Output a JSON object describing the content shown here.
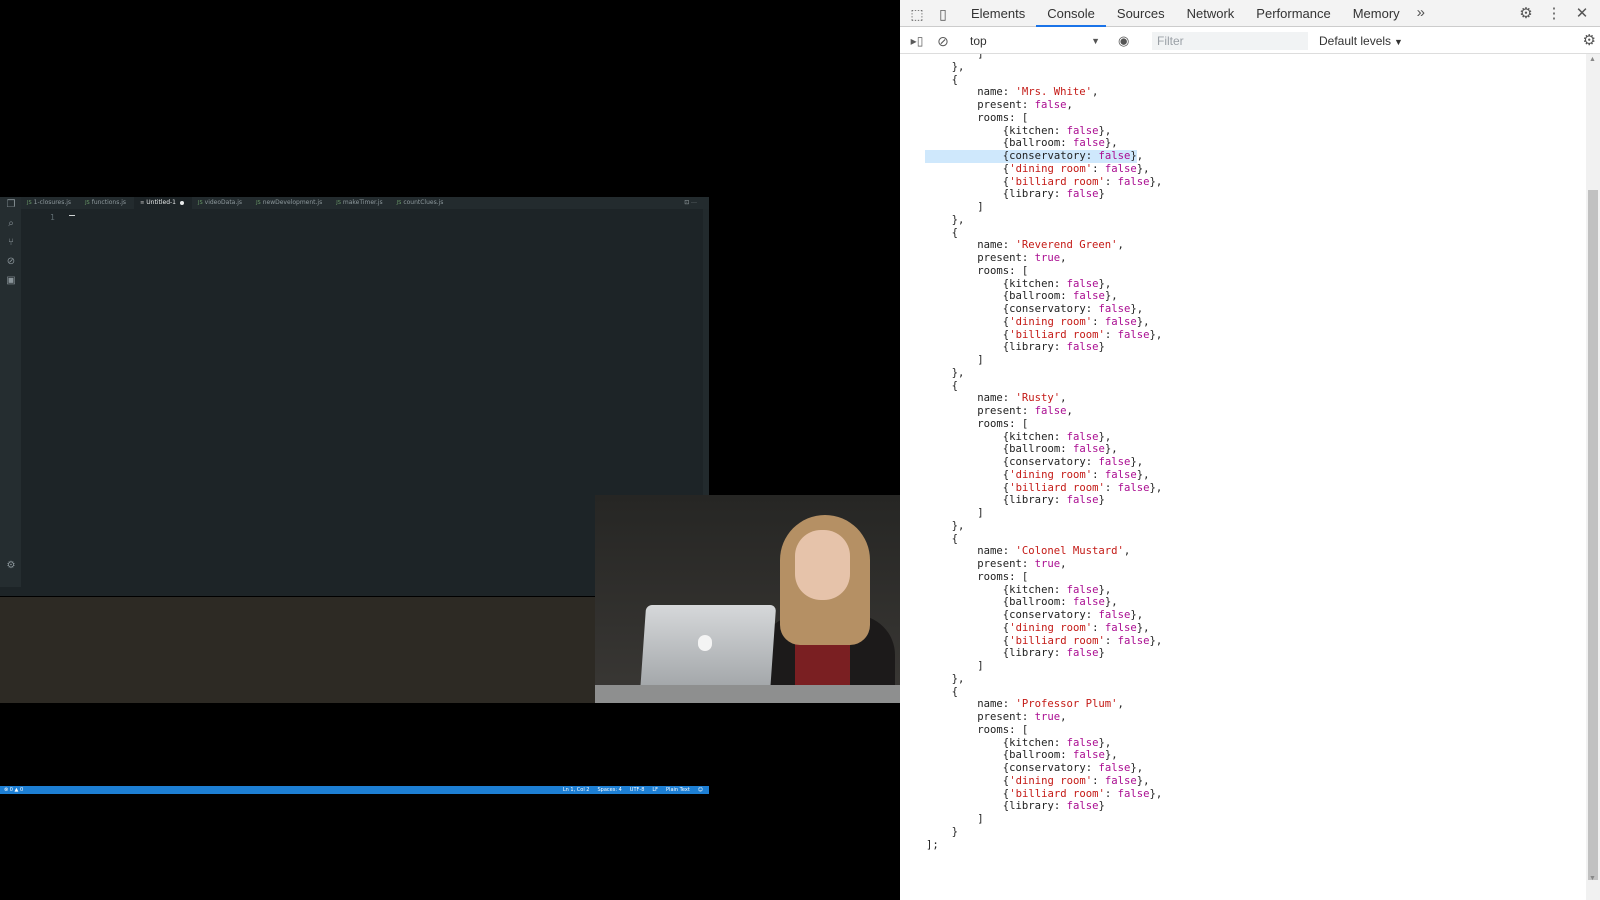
{
  "editor": {
    "tabs": [
      {
        "name": "1-closures.js",
        "active": false
      },
      {
        "name": "functions.js",
        "active": false
      },
      {
        "name": "Untitled-1",
        "active": true,
        "dirty": true
      },
      {
        "name": "videoData.js",
        "active": false
      },
      {
        "name": "newDevelopment.js",
        "active": false
      },
      {
        "name": "makeTimer.js",
        "active": false
      },
      {
        "name": "countClues.js",
        "active": false
      }
    ],
    "file_icon": "js-file-icon",
    "line_number": "1",
    "actions": "⊡  ···",
    "status": {
      "problems": "⊗ 0 ▲ 0",
      "position": "Ln 1, Col 2",
      "spaces": "Spaces: 4",
      "encoding": "UTF-8",
      "eol": "LF",
      "language": "Plain Text",
      "feedback": "☺"
    },
    "status_color": "#1d7fd4"
  },
  "devtools": {
    "tabs": [
      "Elements",
      "Console",
      "Sources",
      "Network",
      "Performance",
      "Memory"
    ],
    "active_tab": "Console",
    "more_icon": "»",
    "context": "top",
    "filter_placeholder": "Filter",
    "levels": "Default levels",
    "icons": {
      "inspect": "inspect-icon",
      "device": "device-toolbar-icon",
      "settings": "gear-icon",
      "menu": "kebab-menu-icon",
      "close": "close-icon",
      "sidebar": "sidebar-toggle-icon",
      "clear": "clear-console-icon",
      "eye": "eye-icon"
    },
    "colors": {
      "active_tab_underline": "#1a73e8",
      "string": "#c41a16",
      "boolean": "#aa0d91",
      "selection": "#cfe8fc"
    }
  },
  "console": {
    "lines": [
      {
        "indent": 8,
        "parts": [
          [
            "p",
            "]"
          ]
        ]
      },
      {
        "indent": 4,
        "parts": [
          [
            "p",
            "},"
          ]
        ]
      },
      {
        "indent": 4,
        "parts": [
          [
            "p",
            "{"
          ]
        ]
      },
      {
        "indent": 8,
        "parts": [
          [
            "k",
            "name: "
          ],
          [
            "s",
            "'Mrs. White'"
          ],
          [
            "p",
            ","
          ]
        ]
      },
      {
        "indent": 8,
        "parts": [
          [
            "k",
            "present: "
          ],
          [
            "b",
            "false"
          ],
          [
            "p",
            ","
          ]
        ]
      },
      {
        "indent": 8,
        "parts": [
          [
            "k",
            "rooms: ["
          ]
        ]
      },
      {
        "indent": 12,
        "parts": [
          [
            "p",
            "{kitchen: "
          ],
          [
            "b",
            "false"
          ],
          [
            "p",
            "},"
          ]
        ]
      },
      {
        "indent": 12,
        "parts": [
          [
            "p",
            "{ballroom: "
          ],
          [
            "b",
            "false"
          ],
          [
            "p",
            "},"
          ]
        ]
      },
      {
        "indent": 12,
        "sel": true,
        "parts": [
          [
            "p",
            "{conservatory: "
          ],
          [
            "b",
            "false"
          ],
          [
            "p",
            "},"
          ]
        ]
      },
      {
        "indent": 12,
        "parts": [
          [
            "p",
            "{"
          ],
          [
            "s",
            "'dining room'"
          ],
          [
            "p",
            ": "
          ],
          [
            "b",
            "false"
          ],
          [
            "p",
            "},"
          ]
        ]
      },
      {
        "indent": 12,
        "parts": [
          [
            "p",
            "{"
          ],
          [
            "s",
            "'billiard room'"
          ],
          [
            "p",
            ": "
          ],
          [
            "b",
            "false"
          ],
          [
            "p",
            "},"
          ]
        ]
      },
      {
        "indent": 12,
        "parts": [
          [
            "p",
            "{library: "
          ],
          [
            "b",
            "false"
          ],
          [
            "p",
            "}"
          ]
        ]
      },
      {
        "indent": 8,
        "parts": [
          [
            "p",
            "]"
          ]
        ]
      },
      {
        "indent": 4,
        "parts": [
          [
            "p",
            "},"
          ]
        ]
      },
      {
        "indent": 4,
        "parts": [
          [
            "p",
            "{"
          ]
        ]
      },
      {
        "indent": 8,
        "parts": [
          [
            "k",
            "name: "
          ],
          [
            "s",
            "'Reverend Green'"
          ],
          [
            "p",
            ","
          ]
        ]
      },
      {
        "indent": 8,
        "parts": [
          [
            "k",
            "present: "
          ],
          [
            "b",
            "true"
          ],
          [
            "p",
            ","
          ]
        ]
      },
      {
        "indent": 8,
        "parts": [
          [
            "k",
            "rooms: ["
          ]
        ]
      },
      {
        "indent": 12,
        "parts": [
          [
            "p",
            "{kitchen: "
          ],
          [
            "b",
            "false"
          ],
          [
            "p",
            "},"
          ]
        ]
      },
      {
        "indent": 12,
        "parts": [
          [
            "p",
            "{ballroom: "
          ],
          [
            "b",
            "false"
          ],
          [
            "p",
            "},"
          ]
        ]
      },
      {
        "indent": 12,
        "parts": [
          [
            "p",
            "{conservatory: "
          ],
          [
            "b",
            "false"
          ],
          [
            "p",
            "},"
          ]
        ]
      },
      {
        "indent": 12,
        "parts": [
          [
            "p",
            "{"
          ],
          [
            "s",
            "'dining room'"
          ],
          [
            "p",
            ": "
          ],
          [
            "b",
            "false"
          ],
          [
            "p",
            "},"
          ]
        ]
      },
      {
        "indent": 12,
        "parts": [
          [
            "p",
            "{"
          ],
          [
            "s",
            "'billiard room'"
          ],
          [
            "p",
            ": "
          ],
          [
            "b",
            "false"
          ],
          [
            "p",
            "},"
          ]
        ]
      },
      {
        "indent": 12,
        "parts": [
          [
            "p",
            "{library: "
          ],
          [
            "b",
            "false"
          ],
          [
            "p",
            "}"
          ]
        ]
      },
      {
        "indent": 8,
        "parts": [
          [
            "p",
            "]"
          ]
        ]
      },
      {
        "indent": 4,
        "parts": [
          [
            "p",
            "},"
          ]
        ]
      },
      {
        "indent": 4,
        "parts": [
          [
            "p",
            "{"
          ]
        ]
      },
      {
        "indent": 8,
        "parts": [
          [
            "k",
            "name: "
          ],
          [
            "s",
            "'Rusty'"
          ],
          [
            "p",
            ","
          ]
        ]
      },
      {
        "indent": 8,
        "parts": [
          [
            "k",
            "present: "
          ],
          [
            "b",
            "false"
          ],
          [
            "p",
            ","
          ]
        ]
      },
      {
        "indent": 8,
        "parts": [
          [
            "k",
            "rooms: ["
          ]
        ]
      },
      {
        "indent": 12,
        "parts": [
          [
            "p",
            "{kitchen: "
          ],
          [
            "b",
            "false"
          ],
          [
            "p",
            "},"
          ]
        ]
      },
      {
        "indent": 12,
        "parts": [
          [
            "p",
            "{ballroom: "
          ],
          [
            "b",
            "false"
          ],
          [
            "p",
            "},"
          ]
        ]
      },
      {
        "indent": 12,
        "parts": [
          [
            "p",
            "{conservatory: "
          ],
          [
            "b",
            "false"
          ],
          [
            "p",
            "},"
          ]
        ]
      },
      {
        "indent": 12,
        "parts": [
          [
            "p",
            "{"
          ],
          [
            "s",
            "'dining room'"
          ],
          [
            "p",
            ": "
          ],
          [
            "b",
            "false"
          ],
          [
            "p",
            "},"
          ]
        ]
      },
      {
        "indent": 12,
        "parts": [
          [
            "p",
            "{"
          ],
          [
            "s",
            "'billiard room'"
          ],
          [
            "p",
            ": "
          ],
          [
            "b",
            "false"
          ],
          [
            "p",
            "},"
          ]
        ]
      },
      {
        "indent": 12,
        "parts": [
          [
            "p",
            "{library: "
          ],
          [
            "b",
            "false"
          ],
          [
            "p",
            "}"
          ]
        ]
      },
      {
        "indent": 8,
        "parts": [
          [
            "p",
            "]"
          ]
        ]
      },
      {
        "indent": 4,
        "parts": [
          [
            "p",
            "},"
          ]
        ]
      },
      {
        "indent": 4,
        "parts": [
          [
            "p",
            "{"
          ]
        ]
      },
      {
        "indent": 8,
        "parts": [
          [
            "k",
            "name: "
          ],
          [
            "s",
            "'Colonel Mustard'"
          ],
          [
            "p",
            ","
          ]
        ]
      },
      {
        "indent": 8,
        "parts": [
          [
            "k",
            "present: "
          ],
          [
            "b",
            "true"
          ],
          [
            "p",
            ","
          ]
        ]
      },
      {
        "indent": 8,
        "parts": [
          [
            "k",
            "rooms: ["
          ]
        ]
      },
      {
        "indent": 12,
        "parts": [
          [
            "p",
            "{kitchen: "
          ],
          [
            "b",
            "false"
          ],
          [
            "p",
            "},"
          ]
        ]
      },
      {
        "indent": 12,
        "parts": [
          [
            "p",
            "{ballroom: "
          ],
          [
            "b",
            "false"
          ],
          [
            "p",
            "},"
          ]
        ]
      },
      {
        "indent": 12,
        "parts": [
          [
            "p",
            "{conservatory: "
          ],
          [
            "b",
            "false"
          ],
          [
            "p",
            "},"
          ]
        ]
      },
      {
        "indent": 12,
        "parts": [
          [
            "p",
            "{"
          ],
          [
            "s",
            "'dining room'"
          ],
          [
            "p",
            ": "
          ],
          [
            "b",
            "false"
          ],
          [
            "p",
            "},"
          ]
        ]
      },
      {
        "indent": 12,
        "parts": [
          [
            "p",
            "{"
          ],
          [
            "s",
            "'billiard room'"
          ],
          [
            "p",
            ": "
          ],
          [
            "b",
            "false"
          ],
          [
            "p",
            "},"
          ]
        ]
      },
      {
        "indent": 12,
        "parts": [
          [
            "p",
            "{library: "
          ],
          [
            "b",
            "false"
          ],
          [
            "p",
            "}"
          ]
        ]
      },
      {
        "indent": 8,
        "parts": [
          [
            "p",
            "]"
          ]
        ]
      },
      {
        "indent": 4,
        "parts": [
          [
            "p",
            "},"
          ]
        ]
      },
      {
        "indent": 4,
        "parts": [
          [
            "p",
            "{"
          ]
        ]
      },
      {
        "indent": 8,
        "parts": [
          [
            "k",
            "name: "
          ],
          [
            "s",
            "'Professor Plum'"
          ],
          [
            "p",
            ","
          ]
        ]
      },
      {
        "indent": 8,
        "parts": [
          [
            "k",
            "present: "
          ],
          [
            "b",
            "true"
          ],
          [
            "p",
            ","
          ]
        ]
      },
      {
        "indent": 8,
        "parts": [
          [
            "k",
            "rooms: ["
          ]
        ]
      },
      {
        "indent": 12,
        "parts": [
          [
            "p",
            "{kitchen: "
          ],
          [
            "b",
            "false"
          ],
          [
            "p",
            "},"
          ]
        ]
      },
      {
        "indent": 12,
        "parts": [
          [
            "p",
            "{ballroom: "
          ],
          [
            "b",
            "false"
          ],
          [
            "p",
            "},"
          ]
        ]
      },
      {
        "indent": 12,
        "parts": [
          [
            "p",
            "{conservatory: "
          ],
          [
            "b",
            "false"
          ],
          [
            "p",
            "},"
          ]
        ]
      },
      {
        "indent": 12,
        "parts": [
          [
            "p",
            "{"
          ],
          [
            "s",
            "'dining room'"
          ],
          [
            "p",
            ": "
          ],
          [
            "b",
            "false"
          ],
          [
            "p",
            "},"
          ]
        ]
      },
      {
        "indent": 12,
        "parts": [
          [
            "p",
            "{"
          ],
          [
            "s",
            "'billiard room'"
          ],
          [
            "p",
            ": "
          ],
          [
            "b",
            "false"
          ],
          [
            "p",
            "},"
          ]
        ]
      },
      {
        "indent": 12,
        "parts": [
          [
            "p",
            "{library: "
          ],
          [
            "b",
            "false"
          ],
          [
            "p",
            "}"
          ]
        ]
      },
      {
        "indent": 8,
        "parts": [
          [
            "p",
            "]"
          ]
        ]
      },
      {
        "indent": 4,
        "parts": [
          [
            "p",
            "}"
          ]
        ]
      },
      {
        "indent": 0,
        "parts": [
          [
            "p",
            "];"
          ]
        ]
      }
    ]
  }
}
